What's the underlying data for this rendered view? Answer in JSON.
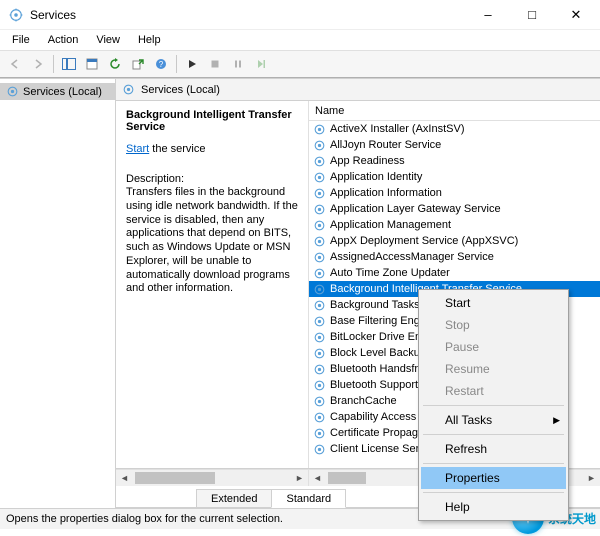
{
  "window": {
    "title": "Services",
    "min_label": "–",
    "max_label": "□",
    "close_label": "✕"
  },
  "menubar": {
    "items": [
      "File",
      "Action",
      "View",
      "Help"
    ]
  },
  "left_pane": {
    "root_label": "Services (Local)"
  },
  "right_header": {
    "title": "Services (Local)"
  },
  "desc_panel": {
    "service_name": "Background Intelligent Transfer Service",
    "start_link": "Start",
    "start_suffix": " the service",
    "desc_label": "Description:",
    "desc_body": "Transfers files in the background using idle network bandwidth. If the service is disabled, then any applications that depend on BITS, such as Windows Update or MSN Explorer, will be unable to automatically download programs and other information."
  },
  "list": {
    "column_header": "Name",
    "items": [
      "ActiveX Installer (AxInstSV)",
      "AllJoyn Router Service",
      "App Readiness",
      "Application Identity",
      "Application Information",
      "Application Layer Gateway Service",
      "Application Management",
      "AppX Deployment Service (AppXSVC)",
      "AssignedAccessManager Service",
      "Auto Time Zone Updater",
      "Background Intelligent Transfer Service",
      "Background Tasks Infrastructure Service",
      "Base Filtering Engine",
      "BitLocker Drive Encryption Service",
      "Block Level Backup Engine Service",
      "Bluetooth Handsfree Service",
      "Bluetooth Support Service",
      "BranchCache",
      "Capability Access Manager Service",
      "Certificate Propagation",
      "Client License Service (ClipSVC)"
    ],
    "selected_index": 10
  },
  "tabs": {
    "items": [
      "Extended",
      "Standard"
    ],
    "active_index": 1
  },
  "statusbar": {
    "text": "Opens the properties dialog box for the current selection."
  },
  "context_menu": {
    "items": [
      {
        "label": "Start",
        "disabled": false
      },
      {
        "label": "Stop",
        "disabled": true
      },
      {
        "label": "Pause",
        "disabled": true
      },
      {
        "label": "Resume",
        "disabled": true
      },
      {
        "label": "Restart",
        "disabled": true
      },
      {
        "sep": true
      },
      {
        "label": "All Tasks",
        "submenu": true
      },
      {
        "sep": true
      },
      {
        "label": "Refresh"
      },
      {
        "sep": true
      },
      {
        "label": "Properties",
        "highlight": true
      },
      {
        "sep": true
      },
      {
        "label": "Help"
      }
    ]
  },
  "watermark": {
    "text": "系统天地"
  }
}
